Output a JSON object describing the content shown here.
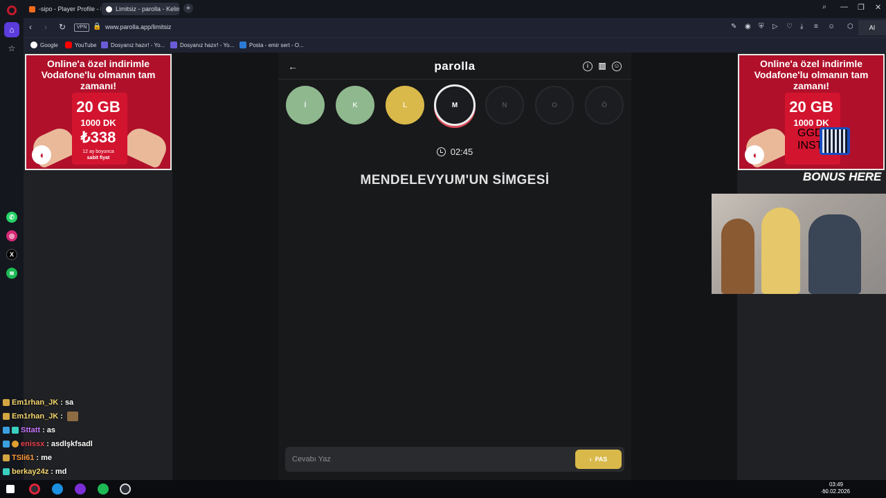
{
  "browser": {
    "tabs": [
      {
        "title": "-sipo - Player Profile - FAC",
        "active": false
      },
      {
        "title": "Limitsiz - parolla - Kelime",
        "active": true
      }
    ],
    "vpn_label": "VPN",
    "url": "www.parolla.app/limitsiz",
    "ai_label": "AI",
    "bookmarks": [
      "Google",
      "YouTube",
      "Dosyanız hazır! - Yo...",
      "Dosyanız hazır! - Yo...",
      "Posta - emir sert - O..."
    ]
  },
  "ads": {
    "left": {
      "headline": "Online'a özel indirimle Vodafone'lu olmanın tam zamanı!",
      "data": "20 GB",
      "minutes": "1000 DK",
      "price": "₺338",
      "note1": "12 ay boyunca",
      "note2": "sabit fiyat"
    },
    "right": {
      "headline": "Online'a özel indirimle Vodafone'lu olmanın tam zamanı!",
      "data": "20 GB",
      "minutes": "1000 DK"
    }
  },
  "game": {
    "logo": "parolla",
    "letters": [
      {
        "letter": "İ",
        "state": "correct"
      },
      {
        "letter": "K",
        "state": "correct"
      },
      {
        "letter": "L",
        "state": "passed"
      },
      {
        "letter": "M",
        "state": "current"
      },
      {
        "letter": "N",
        "state": "pending"
      },
      {
        "letter": "O",
        "state": "pending"
      },
      {
        "letter": "Ö",
        "state": "pending"
      }
    ],
    "timer": "02:45",
    "question": "MENDELEVYUM'UN SİMGESİ",
    "answer_placeholder": "Cevabı Yaz",
    "pass_label": "PAS"
  },
  "overlay": {
    "brand": "GGDROP",
    "instant": "INSTANT",
    "bonus": "BONUS HERE"
  },
  "chat": [
    {
      "user": "Em1rhan_JK",
      "message": "sa",
      "color": "#f5d76e"
    },
    {
      "user": "Em1rhan_JK",
      "message": "",
      "color": "#f5d76e"
    },
    {
      "user": "Sttatt",
      "message": "as",
      "color": "#c777ff"
    },
    {
      "user": "enissx",
      "message": "asdlşkfsadl",
      "color": "#e8434f"
    },
    {
      "user": "TSli61",
      "message": "me",
      "color": "#ff9a3c"
    },
    {
      "user": "berkay24z",
      "message": "md",
      "color": "#f5d76e"
    }
  ],
  "taskbar": {
    "time": "03:49",
    "date": "10.02.2026"
  },
  "colors": {
    "correct": "#8fb88f",
    "passed": "#d9b94a",
    "accent": "#5b3cdd"
  }
}
